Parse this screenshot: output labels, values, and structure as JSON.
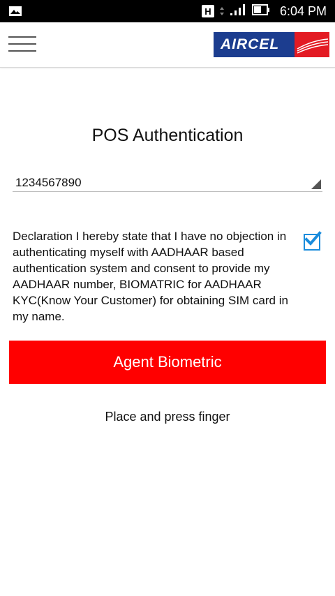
{
  "status_bar": {
    "network_type": "H",
    "time": "6:04 PM",
    "icons": [
      "photo-notification-icon",
      "data-arrows-icon",
      "signal-icon",
      "battery-icon"
    ]
  },
  "app_bar": {
    "menu_icon": "hamburger-menu-icon",
    "logo_text": "AIRCEL",
    "colors": {
      "logo_blue": "#1c3d8f",
      "logo_red": "#e31b23"
    }
  },
  "main": {
    "title": "POS Authentication",
    "dropdown": {
      "value": "1234567890"
    },
    "declaration_text": "Declaration I hereby state that I have no objection in authenticating myself with AADHAAR based authentication system and consent to provide my AADHAAR number, BIOMATRIC for AADHAAR KYC(Know Your Customer) for obtaining SIM card in my name.",
    "declaration_checked": true,
    "agent_button_label": "Agent Biometric",
    "instruction": "Place and press finger",
    "colors": {
      "button_red": "#ff0000",
      "checkbox_blue": "#1a8cdc"
    }
  }
}
